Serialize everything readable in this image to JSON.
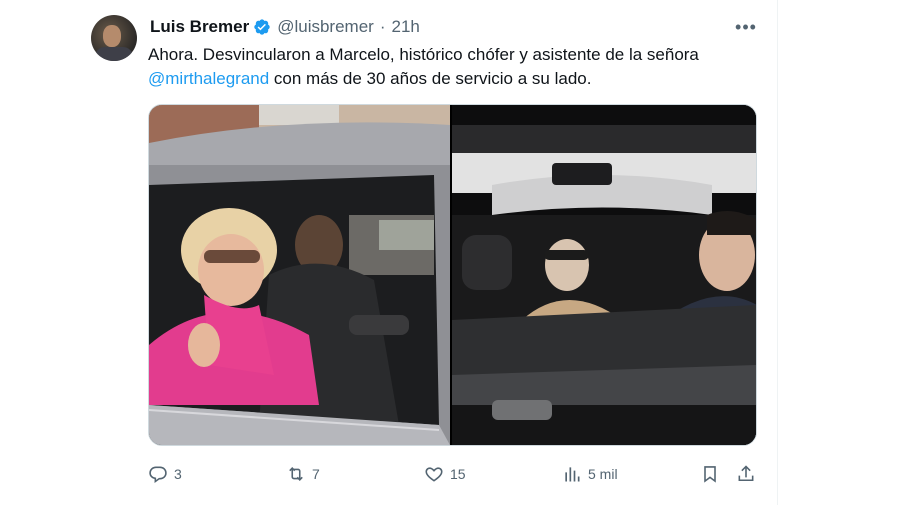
{
  "tweet": {
    "author_name": "Luis Bremer",
    "handle": "@luisbremer",
    "separator": "·",
    "time": "21h",
    "more_label": "•••",
    "text_before": "Ahora.  Desvincularon a Marcelo,  histórico chófer y asistente de la señora ",
    "mention": "@mirthalegrand",
    "text_after": " con más de 30 años de servicio a su lado."
  },
  "actions": {
    "replies": "3",
    "reposts": "7",
    "likes": "15",
    "views": "5 mil"
  },
  "colors": {
    "accent": "#1d9bf0",
    "secondary_text": "#536471",
    "primary_text": "#0f1419"
  },
  "icons": [
    "verified-badge-icon",
    "more-icon",
    "reply-icon",
    "repost-icon",
    "like-icon",
    "views-icon",
    "bookmark-icon",
    "share-icon"
  ]
}
